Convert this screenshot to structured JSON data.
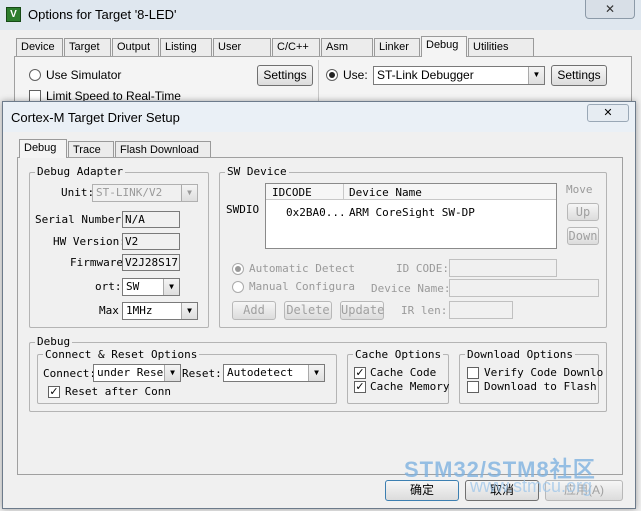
{
  "outer_window": {
    "title": "Options for Target '8-LED'",
    "icon": "uvision-app-icon",
    "tabs": [
      "Device",
      "Target",
      "Output",
      "Listing",
      "User",
      "C/C++",
      "Asm",
      "Linker",
      "Debug",
      "Utilities"
    ],
    "active_tab": "Debug",
    "use_simulator_label": "Use Simulator",
    "limit_speed_label": "Limit Speed to Real-Time",
    "settings_label": "Settings",
    "use_label": "Use:",
    "debugger_value": "ST-Link Debugger",
    "settings2_label": "Settings"
  },
  "dialog": {
    "title": "Cortex-M Target Driver Setup",
    "tabs": [
      "Debug",
      "Trace",
      "Flash Download"
    ],
    "active_tab": "Debug",
    "debug_adapter": {
      "title": "Debug Adapter",
      "unit_label": "Unit:",
      "unit_value": "ST-LINK/V2",
      "serial_label": "Serial Number:",
      "serial_value": "N/A",
      "hw_label": "HW Version:",
      "hw_value": "V2",
      "firmware_label": "Firmware",
      "firmware_value": "V2J28S17",
      "port_label": "ort:",
      "port_value": "SW",
      "max_label": "Max",
      "max_value": "1MHz"
    },
    "sw_device": {
      "title": "SW Device",
      "swdio_label": "SWDIO",
      "col_idcode": "IDCODE",
      "col_device": "Device Name",
      "row_idcode": "0x2BA0...",
      "row_device": "ARM CoreSight SW-DP",
      "move_label": "Move",
      "up_label": "Up",
      "down_label": "Down",
      "auto_detect_label": "Automatic Detectio",
      "manual_config_label": "Manual Configurati",
      "id_code_label": "ID CODE:",
      "device_name_label": "Device Name:",
      "add_label": "Add",
      "delete_label": "Delete",
      "update_label": "Update",
      "ir_len_label": "IR len:"
    },
    "debug_group": {
      "title": "Debug",
      "connect_reset_title": "Connect & Reset Options",
      "connect_label": "Connect:",
      "connect_value": "under Reset",
      "reset_label": "Reset:",
      "reset_value": "Autodetect",
      "reset_after_conn_label": "Reset after Conn"
    },
    "cache_options": {
      "title": "Cache Options",
      "cache_code_label": "Cache Code",
      "cache_memory_label": "Cache Memory"
    },
    "download_options": {
      "title": "Download Options",
      "verify_label": "Verify Code Downlo",
      "download_flash_label": "Download to Flash"
    },
    "ok_label": "确定",
    "cancel_label": "取消",
    "apply_label": "应用(A)"
  },
  "watermark": {
    "line1": "STM32/STM8社区",
    "line2": "www.stmcu.org"
  }
}
